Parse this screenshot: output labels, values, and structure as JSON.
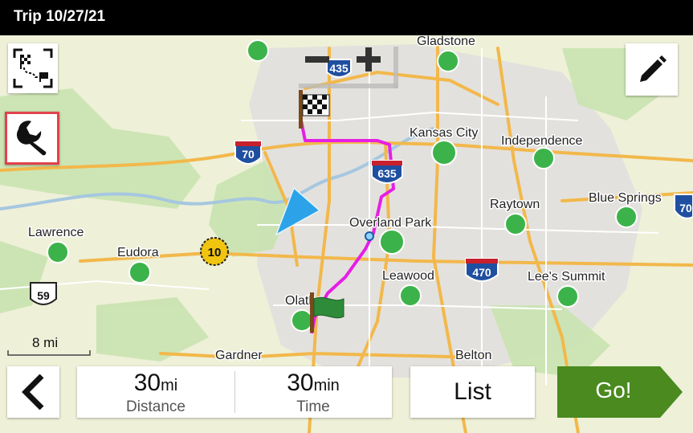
{
  "title": "Trip 10/27/21",
  "map": {
    "cities": [
      "Gladstone",
      "Kansas City",
      "Independence",
      "Raytown",
      "Blue Springs",
      "Lawrence",
      "Eudora",
      "Overland Park",
      "Leawood",
      "Lee's Summit",
      "Olathe",
      "Gardner",
      "Belton"
    ],
    "shields": [
      "435",
      "70",
      "635",
      "10",
      "470",
      "59",
      "70"
    ],
    "scale_label": "8 mi"
  },
  "icons": {
    "route_overview": "route-overview-icon",
    "tools": "wrench-icon",
    "edit": "pencil-icon",
    "back": "chevron-left-icon",
    "zoom_out": "minus-icon",
    "zoom_in": "plus-icon"
  },
  "stats": {
    "distance_value": "30",
    "distance_unit": "mi",
    "distance_label": "Distance",
    "time_value": "30",
    "time_unit": "min",
    "time_label": "Time"
  },
  "buttons": {
    "list_label": "List",
    "go_label": "Go!"
  },
  "colors": {
    "route": "#e61ee6",
    "go_button": "#4a8a1f",
    "tools_border": "#e0424c",
    "city_dot": "#3cb34a"
  }
}
